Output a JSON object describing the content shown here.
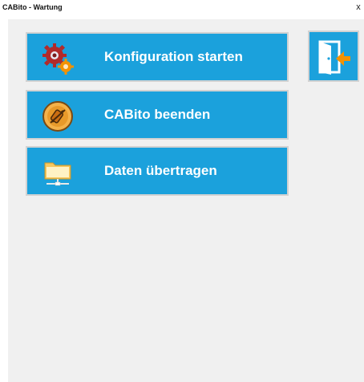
{
  "window": {
    "title": "CABito - Wartung",
    "close_glyph": "x"
  },
  "menu": {
    "items": [
      {
        "label": "Konfiguration starten",
        "icon": "gears-icon"
      },
      {
        "label": "CABito beenden",
        "icon": "shutdown-icon"
      },
      {
        "label": "Daten übertragen",
        "icon": "network-folder-icon"
      }
    ]
  },
  "exit": {
    "icon": "exit-door-icon"
  },
  "colors": {
    "button_blue": "#1ba1dc",
    "panel_gray": "#f0f0f0",
    "button_border": "#d2d2d2",
    "accent_orange": "#f39200"
  }
}
